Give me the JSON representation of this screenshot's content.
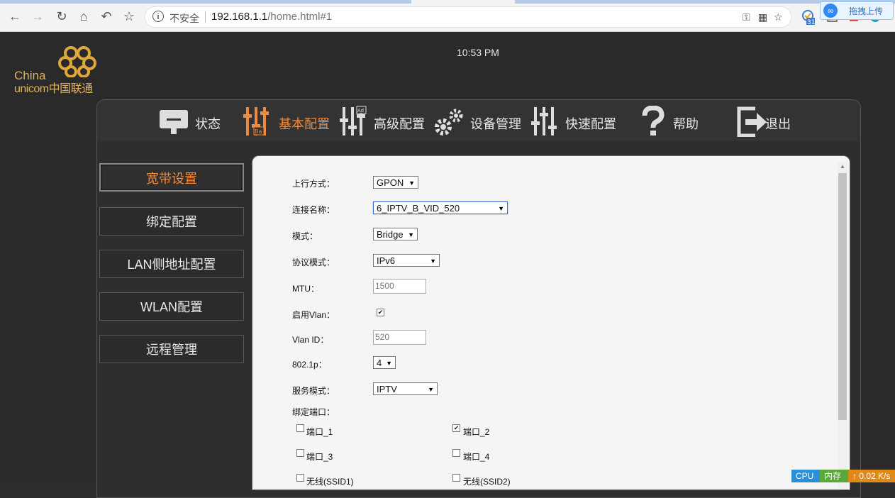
{
  "browser": {
    "insecure_label": "不安全",
    "url_host": "192.168.1.1",
    "url_path": "/home.html#1",
    "ext_badge": "31",
    "upload_label": "拖拽上传"
  },
  "header": {
    "clock": "10:53 PM",
    "logo_line1": "China",
    "logo_line2": "unicom中国联通"
  },
  "menu": [
    {
      "label": "状态",
      "icon": "monitor-icon"
    },
    {
      "label": "基本配置",
      "icon": "sliders-icon",
      "active": true,
      "badge": "Ba"
    },
    {
      "label": "高级配置",
      "icon": "sliders-icon",
      "badge": "Ad"
    },
    {
      "label": "设备管理",
      "icon": "gears-icon"
    },
    {
      "label": "快速配置",
      "icon": "sliders-icon"
    },
    {
      "label": "帮助",
      "icon": "question-icon"
    },
    {
      "label": "退出",
      "icon": "exit-icon"
    }
  ],
  "sidebar": [
    {
      "label": "宽带设置",
      "active": true
    },
    {
      "label": "绑定配置"
    },
    {
      "label": "LAN侧地址配置"
    },
    {
      "label": "WLAN配置"
    },
    {
      "label": "远程管理"
    }
  ],
  "form": {
    "uplink_label": "上行方式：",
    "uplink_value": "GPON",
    "conn_name_label": "连接名称：",
    "conn_name_value": "6_IPTV_B_VID_520",
    "mode_label": "模式：",
    "mode_value": "Bridge",
    "protocol_label": "协议模式：",
    "protocol_value": "IPv6",
    "mtu_label": "MTU：",
    "mtu_value": "1500",
    "vlan_enable_label": "启用Vlan：",
    "vlan_enable_checked": true,
    "vlan_id_label": "Vlan ID：",
    "vlan_id_value": "520",
    "p8021_label": "802.1p：",
    "p8021_value": "4",
    "service_label": "服务模式：",
    "service_value": "IPTV",
    "bind_label": "绑定端口：",
    "ports": [
      {
        "label": "端口_1",
        "checked": false
      },
      {
        "label": "端口_2",
        "checked": true
      },
      {
        "label": "端口_3",
        "checked": false
      },
      {
        "label": "端口_4",
        "checked": false
      },
      {
        "label": "无线(SSID1)",
        "checked": false
      },
      {
        "label": "无线(SSID2)",
        "checked": false
      }
    ]
  },
  "status_strip": {
    "cpu": "CPU",
    "mem": "内存",
    "net": "0.02 K/s"
  },
  "colors": {
    "accent": "#f08a3c",
    "page_bg": "#2a2a2a",
    "content_bg": "#f5f5f5"
  }
}
